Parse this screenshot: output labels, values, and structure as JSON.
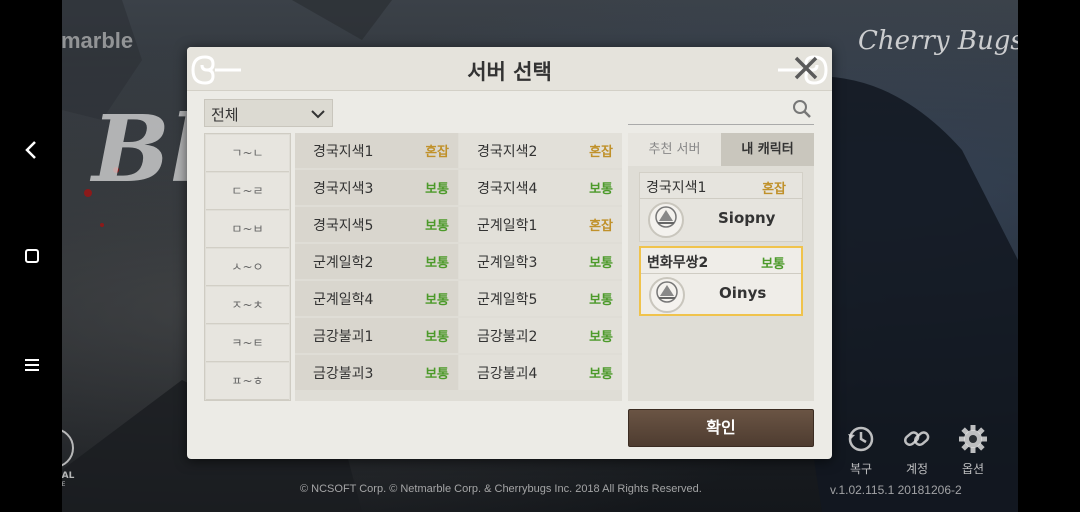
{
  "background": {
    "netmarble_logo": "netmarble",
    "cherry_logo": "Cherry Bugs",
    "game_logo": "Bl",
    "unreal_logo": "UNREAL",
    "unreal_sub": "ENGINE",
    "copyright": "© NCSOFT Corp. © Netmarble Corp. & Cherrybugs Inc. 2018 All Rights Reserved.",
    "version": "v.1.02.115.1  20181206-2",
    "bottom_buttons": [
      {
        "label": "복구",
        "icon": "restore-icon"
      },
      {
        "label": "계정",
        "icon": "link-icon"
      },
      {
        "label": "옵션",
        "icon": "gear-icon"
      }
    ]
  },
  "dialog": {
    "title": "서버 선택",
    "close_icon": "close-icon",
    "filter": {
      "selected": "전체"
    },
    "search": {
      "placeholder": ""
    },
    "consonants": [
      "ㄱ~ㄴ",
      "ㄷ~ㄹ",
      "ㅁ~ㅂ",
      "ㅅ~ㅇ",
      "ㅈ~ㅊ",
      "ㅋ~ㅌ",
      "ㅍ~ㅎ"
    ],
    "servers": [
      [
        {
          "name": "경국지색1",
          "status": "혼잡"
        },
        {
          "name": "경국지색2",
          "status": "혼잡"
        }
      ],
      [
        {
          "name": "경국지색3",
          "status": "보통"
        },
        {
          "name": "경국지색4",
          "status": "보통"
        }
      ],
      [
        {
          "name": "경국지색5",
          "status": "보통"
        },
        {
          "name": "군계일학1",
          "status": "혼잡"
        }
      ],
      [
        {
          "name": "군계일학2",
          "status": "보통"
        },
        {
          "name": "군계일학3",
          "status": "보통"
        }
      ],
      [
        {
          "name": "군계일학4",
          "status": "보통"
        },
        {
          "name": "군계일학5",
          "status": "보통"
        }
      ],
      [
        {
          "name": "금강불괴1",
          "status": "보통"
        },
        {
          "name": "금강불괴2",
          "status": "보통"
        }
      ],
      [
        {
          "name": "금강불괴3",
          "status": "보통"
        },
        {
          "name": "금강불괴4",
          "status": "보통"
        }
      ]
    ],
    "tabs": {
      "recommended": "추천 서버",
      "my_characters": "내 캐릭터"
    },
    "characters": [
      {
        "server": "경국지색1",
        "status": "혼잡",
        "name": "Siopny",
        "selected": false
      },
      {
        "server": "변화무쌍2",
        "status": "보통",
        "name": "Oinys",
        "selected": true
      }
    ],
    "confirm_label": "확인"
  },
  "colors": {
    "status_busy": "#c0912a",
    "status_normal": "#4c9a2a",
    "selected_border": "#f0c34c",
    "confirm_bg": "#5a4638"
  }
}
